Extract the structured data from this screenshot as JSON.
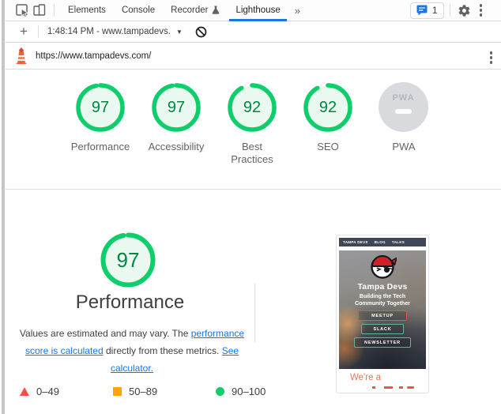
{
  "devtools": {
    "tabs": [
      "Elements",
      "Console",
      "Recorder",
      "Lighthouse"
    ],
    "more_tabs": "»",
    "messages_count": "1"
  },
  "report_toolbar": {
    "new_report": "+",
    "report_dropdown": "1:48:14 PM - www.tampadevs.",
    "dropdown_caret": "▼"
  },
  "url_bar": {
    "url": "https://www.tampadevs.com/"
  },
  "summary": {
    "scores": [
      {
        "label": "Performance",
        "score": "97"
      },
      {
        "label": "Accessibility",
        "score": "97"
      },
      {
        "label": "Best Practices",
        "score": "92"
      },
      {
        "label": "SEO",
        "score": "92"
      },
      {
        "label": "PWA",
        "badge": "PWA"
      }
    ]
  },
  "performance": {
    "score": "97",
    "title": "Performance",
    "description": {
      "part1": "Values are estimated and may vary. The ",
      "link1": "performance score is calculated",
      "part2": " directly from these metrics. ",
      "link2": "See calculator."
    },
    "legend_ranges": [
      "0–49",
      "50–89",
      "90–100"
    ]
  },
  "screenshot": {
    "nav": [
      "TAMPA DEVS",
      "BLOG",
      "TALKS"
    ],
    "title": "Tampa Devs",
    "tagline_line1": "Building the Tech",
    "tagline_line2": "Community Together",
    "buttons": [
      "MEETUP",
      "SLACK",
      "NEWSLETTER"
    ],
    "partial_text": "We're a"
  },
  "colors": {
    "pass_green": "#0cce6b",
    "score_text_green": "#018642",
    "average_orange": "#ffa400",
    "fail_red": "#ff4e42",
    "link_blue": "#1a73e8",
    "active_tab_blue": "#1a73e8"
  }
}
